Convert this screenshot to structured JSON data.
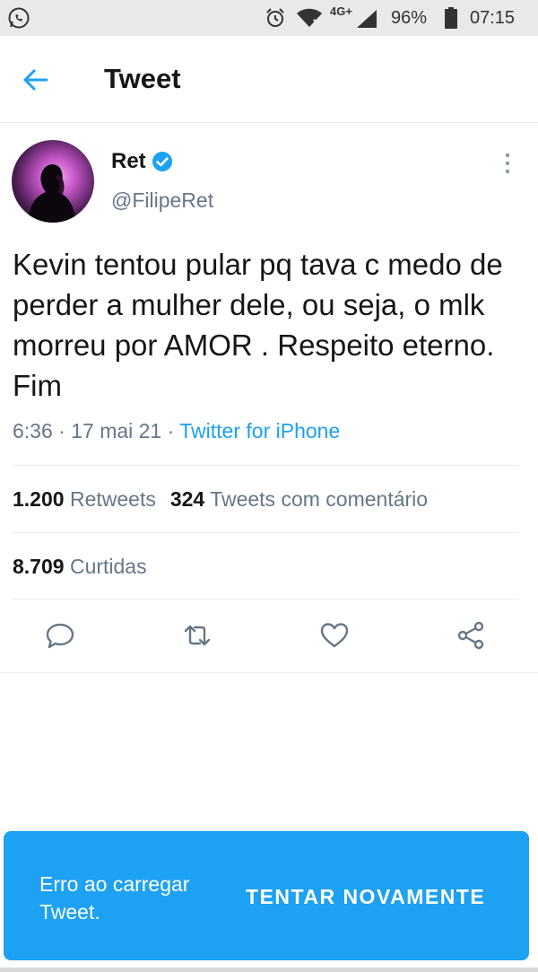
{
  "status_bar": {
    "network": "4G+",
    "battery": "96%",
    "time": "07:15"
  },
  "header": {
    "title": "Tweet"
  },
  "tweet": {
    "author_name": "Ret",
    "handle": "@FilipeRet",
    "text": "Kevin tentou pular pq tava c medo de perder a mulher dele, ou seja, o mlk morreu por AMOR . Respeito eterno. Fim",
    "time": "6:36",
    "date": "17 mai 21",
    "source": "Twitter for iPhone"
  },
  "stats": {
    "retweets_count": "1.200",
    "retweets_label": "Retweets",
    "quotes_count": "324",
    "quotes_label": "Tweets com comentário",
    "likes_count": "8.709",
    "likes_label": "Curtidas"
  },
  "snackbar": {
    "message": "Erro ao carregar Tweet.",
    "action": "TENTAR NOVAMENTE"
  },
  "colors": {
    "accent": "#1da1f2",
    "text": "#14171a",
    "secondary": "#657786"
  }
}
